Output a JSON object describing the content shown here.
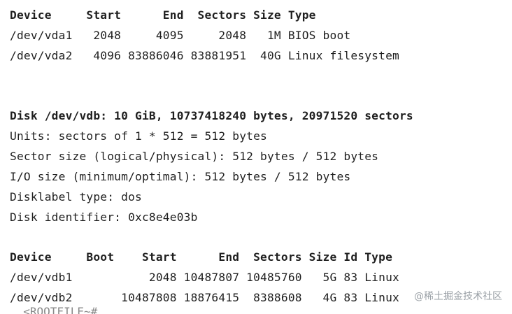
{
  "colors": {
    "background": "#ffffff",
    "text": "#1f1f1f",
    "muted": "#8a8a8a",
    "watermark": "#9aa0a6"
  },
  "vda_table": {
    "header": "Device     Start      End  Sectors Size Type",
    "rows": [
      "/dev/vda1   2048     4095     2048   1M BIOS boot",
      "/dev/vda2   4096 83886046 83881951  40G Linux filesystem"
    ]
  },
  "vdb_info": {
    "disk_line": "Disk /dev/vdb: 10 GiB, 10737418240 bytes, 20971520 sectors",
    "units": "Units: sectors of 1 * 512 = 512 bytes",
    "sector_size": "Sector size (logical/physical): 512 bytes / 512 bytes",
    "io_size": "I/O size (minimum/optimal): 512 bytes / 512 bytes",
    "disklabel": "Disklabel type: dos",
    "identifier": "Disk identifier: 0xc8e4e03b"
  },
  "vdb_table": {
    "header": "Device     Boot    Start      End  Sectors Size Id Type",
    "rows": [
      "/dev/vdb1           2048 10487807 10485760   5G 83 Linux",
      "/dev/vdb2       10487808 18876415  8388608   4G 83 Linux"
    ]
  },
  "cut_line": "  <ROOTFILE~#",
  "watermark": "@稀土掘金技术社区"
}
